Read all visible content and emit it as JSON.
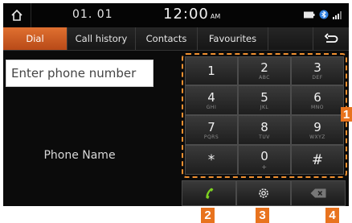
{
  "status": {
    "date": "01. 01",
    "time": "12:00",
    "ampm": "AM",
    "icons": [
      "battery-icon",
      "bluetooth-icon",
      "signal-icon"
    ]
  },
  "tabs": [
    "Dial",
    "Call history",
    "Contacts",
    "Favourites"
  ],
  "active_tab": "Dial",
  "input": {
    "placeholder": "Enter phone number"
  },
  "phone_name": "Phone Name",
  "keys": [
    {
      "main": "1",
      "sub": ""
    },
    {
      "main": "2",
      "sub": "ABC"
    },
    {
      "main": "3",
      "sub": "DEF"
    },
    {
      "main": "4",
      "sub": "GHI"
    },
    {
      "main": "5",
      "sub": "JKL"
    },
    {
      "main": "6",
      "sub": "MNO"
    },
    {
      "main": "7",
      "sub": "PQRS"
    },
    {
      "main": "8",
      "sub": "TUV"
    },
    {
      "main": "9",
      "sub": "WXYZ"
    },
    {
      "main": "*",
      "sub": ""
    },
    {
      "main": "0",
      "sub": "+"
    },
    {
      "main": "#",
      "sub": ""
    }
  ],
  "actions": [
    "call-icon",
    "settings-icon",
    "backspace-icon"
  ],
  "callouts": [
    "1",
    "2",
    "3",
    "4"
  ],
  "colors": {
    "accent": "#e8731e",
    "call_green": "#7ed321",
    "background": "#0b0b0b"
  }
}
